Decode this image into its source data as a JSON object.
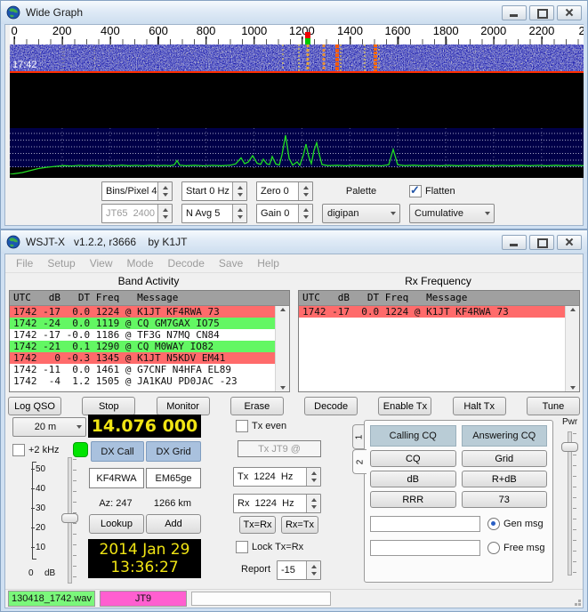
{
  "palette": {
    "decode_red": "#ff6b6b",
    "decode_green": "#63f763",
    "lcd_bg": "#000000",
    "lcd_text": "#f0e414",
    "lamp_green": "#00e400",
    "dx_button_bg": "#a9c1de",
    "msg_header_bg": "#b9ccd6",
    "wav_label_bg": "#7bf77b",
    "mode_label_bg": "#ff5fd0",
    "waterfall_blue": "#0000a0",
    "spectrum_trace": "#22dd22"
  },
  "wide_graph": {
    "title": "Wide Graph",
    "scale_labels": [
      "0",
      "200",
      "400",
      "600",
      "800",
      "1000",
      "1200",
      "1400",
      "1600",
      "1800",
      "2000",
      "2200",
      "2"
    ],
    "waterfall_timestamp": "17:42",
    "signal_frequencies_hz": [
      1119,
      1186,
      1224,
      1290,
      1345,
      1461,
      1505
    ],
    "marker_frequency_hz": 1224,
    "controls": {
      "bins_per_pixel": "Bins/Pixel 4",
      "start": "Start 0 Hz",
      "zero": "Zero 0",
      "palette_label": "Palette",
      "flatten_label": "Flatten",
      "jt65_jt9_split": "JT65  2400  JT9",
      "n_avg": "N Avg 5",
      "gain": "Gain 0",
      "palette_value": "digipan",
      "spectrum_mode": "Cumulative"
    }
  },
  "main": {
    "title": "WSJT-X   v1.2.2, r3666    by K1JT",
    "menu": [
      "File",
      "Setup",
      "View",
      "Mode",
      "Decode",
      "Save",
      "Help"
    ],
    "band_activity": {
      "title": "Band Activity",
      "header": "UTC   dB   DT Freq   Message",
      "rows": [
        {
          "text": "1742 -17  0.0 1224 @ K1JT KF4RWA 73",
          "highlight": "red"
        },
        {
          "text": "1742 -24  0.0 1119 @ CQ GM7GAX IO75",
          "highlight": "green"
        },
        {
          "text": "1742 -17 -0.0 1186 @ TF3G N7MQ CN84",
          "highlight": "none"
        },
        {
          "text": "1742 -21  0.1 1290 @ CQ M0WAY IO82",
          "highlight": "green"
        },
        {
          "text": "1742   0 -0.3 1345 @ K1JT N5KDV EM41",
          "highlight": "red"
        },
        {
          "text": "1742 -11  0.0 1461 @ G7CNF N4HFA EL89",
          "highlight": "none"
        },
        {
          "text": "1742  -4  1.2 1505 @ JA1KAU PD0JAC -23",
          "highlight": "none"
        }
      ]
    },
    "rx_frequency": {
      "title": "Rx Frequency",
      "header": "UTC   dB   DT Freq   Message",
      "rows": [
        {
          "text": "1742 -17  0.0 1224 @ K1JT KF4RWA 73",
          "highlight": "red"
        }
      ]
    },
    "action_buttons": [
      "Log QSO",
      "Stop",
      "Monitor",
      "Erase",
      "Decode",
      "Enable Tx",
      "Halt Tx",
      "Tune"
    ],
    "band_select": "20 m",
    "frequency_display": "14.076 000",
    "plus2khz_label": "+2 kHz",
    "dx_call_label": "DX Call",
    "dx_grid_label": "DX Grid",
    "dx_call_value": "KF4RWA",
    "dx_grid_value": "EM65ge",
    "azimuth": "Az: 247",
    "distance": "1266 km",
    "lookup_label": "Lookup",
    "add_label": "Add",
    "date_display": "2014 Jan 29",
    "time_display": "13:36:27",
    "db_scale": {
      "ticks": [
        "50",
        "40",
        "30",
        "20",
        "10"
      ],
      "zero": "0",
      "unit": "dB"
    },
    "tx_even_label": "Tx even",
    "tx_jt9_label": "Tx JT9  @",
    "tx_freq": "Tx  1224  Hz",
    "rx_freq": "Rx  1224  Hz",
    "tx_eq_rx": "Tx=Rx",
    "rx_eq_tx": "Rx=Tx",
    "lock_label": "Lock Tx=Rx",
    "report_label": "Report",
    "report_value": "-15",
    "messages": {
      "tab1": "1",
      "tab2": "2",
      "col1_header": "Calling CQ",
      "col2_header": "Answering CQ",
      "buttons": [
        [
          "CQ",
          "Grid"
        ],
        [
          "dB",
          "R+dB"
        ],
        [
          "RRR",
          "73"
        ]
      ],
      "gen_msg_label": "Gen msg",
      "free_msg_label": "Free msg",
      "gen_msg_value": "",
      "free_msg_value": ""
    },
    "pwr_label": "Pwr",
    "status": {
      "wav_file": "130418_1742.wav",
      "mode": "JT9"
    }
  }
}
